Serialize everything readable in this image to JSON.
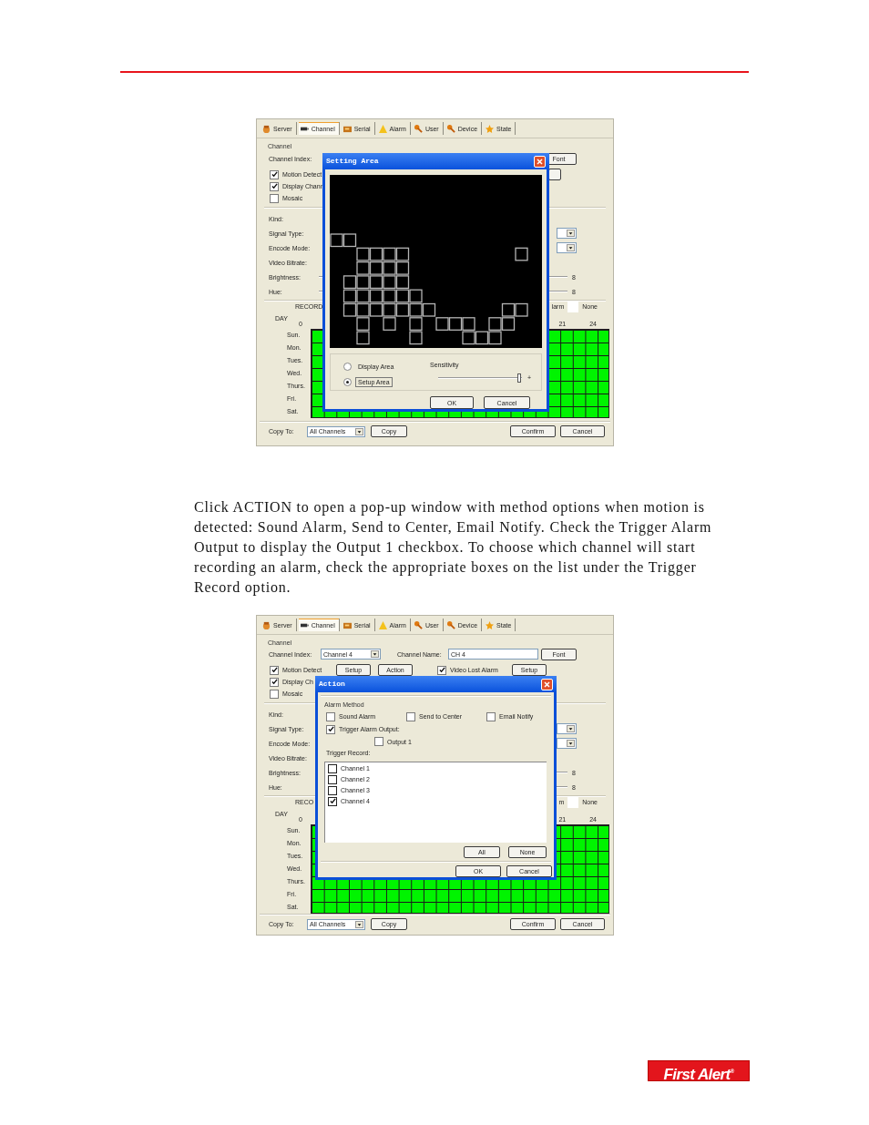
{
  "screenshots": [
    {
      "tabs": [
        {
          "label": "Server",
          "selected": false
        },
        {
          "label": "Channel",
          "selected": true
        },
        {
          "label": "Serial",
          "selected": false
        },
        {
          "label": "Alarm",
          "selected": false
        },
        {
          "label": "User",
          "selected": false
        },
        {
          "label": "Device",
          "selected": false
        },
        {
          "label": "State",
          "selected": false
        }
      ],
      "group_title": "Channel",
      "channel_row": {
        "index_label": "Channel Index:",
        "font_button": "Font"
      },
      "checks": [
        {
          "label": "Motion Detect",
          "checked": true,
          "extras": [
            {
              "kind": "stub"
            }
          ]
        },
        {
          "label": "Display Chann",
          "checked": true
        },
        {
          "label": "Mosaic",
          "checked": false
        }
      ],
      "fields": [
        {
          "label": "Kind:",
          "kind": "plain"
        },
        {
          "label": "Signal Type:",
          "kind": "dropdown"
        },
        {
          "label": "Encode Mode:",
          "kind": "dropdown"
        },
        {
          "label": "Video Bitrate:",
          "kind": "plain"
        },
        {
          "label": "Brightness:",
          "kind": "slider",
          "value": "8"
        },
        {
          "label": "Hue:",
          "kind": "slider",
          "value": "8"
        }
      ],
      "schedule": {
        "record_label": "RECORD",
        "legend_label": "larm",
        "legend_value": "None",
        "day_label": "DAY",
        "hours": [
          "0",
          "21",
          "24"
        ],
        "days": [
          "Sun.",
          "Mon.",
          "Tues.",
          "Wed.",
          "Thurs.",
          "Fri.",
          "Sat."
        ]
      },
      "copy_row": {
        "label": "Copy To:",
        "select": "All Channels",
        "button": "Copy"
      },
      "actions": [
        "Confirm",
        "Cancel"
      ],
      "dialog": {
        "kind": "area",
        "title": "Setting Area",
        "options": [
          {
            "label": "Display Area",
            "selected": false
          },
          {
            "label": "Setup Area",
            "selected": true
          }
        ],
        "sensitivity": {
          "label": "Sensitivity",
          "level": 0.97,
          "plus": "+"
        },
        "buttons": [
          "OK",
          "Cancel"
        ]
      }
    },
    {
      "tabs": [
        {
          "label": "Server",
          "selected": false
        },
        {
          "label": "Channel",
          "selected": true
        },
        {
          "label": "Serial",
          "selected": false
        },
        {
          "label": "Alarm",
          "selected": false
        },
        {
          "label": "User",
          "selected": false
        },
        {
          "label": "Device",
          "selected": false
        },
        {
          "label": "State",
          "selected": false
        }
      ],
      "group_title": "Channel",
      "channel_row": {
        "index_label": "Channel Index:",
        "index_value": "Channel 4",
        "name_label": "Channel Name:",
        "name_value": "CH 4",
        "font_button": "Font"
      },
      "checks": [
        {
          "label": "Motion Detect",
          "checked": true,
          "extras": [
            {
              "kind": "button",
              "label": "Setup"
            },
            {
              "kind": "button",
              "label": "Action"
            },
            {
              "kind": "check",
              "label": "Video Lost Alarm",
              "checked": true
            },
            {
              "kind": "button",
              "label": "Setup"
            }
          ]
        },
        {
          "label": "Display Ch",
          "checked": true
        },
        {
          "label": "Mosaic",
          "checked": false
        }
      ],
      "fields": [
        {
          "label": "Kind:",
          "kind": "plain"
        },
        {
          "label": "Signal Type:",
          "kind": "dropdown"
        },
        {
          "label": "Encode Mode:",
          "kind": "dropdown"
        },
        {
          "label": "Video Bitrate:",
          "kind": "plain"
        },
        {
          "label": "Brightness:",
          "kind": "slider",
          "value": "8"
        },
        {
          "label": "Hue:",
          "kind": "slider",
          "value": "8"
        }
      ],
      "schedule": {
        "record_label": "RECO",
        "legend_label": "m",
        "legend_value": "None",
        "day_label": "DAY",
        "hours": [
          "0",
          "21",
          "24"
        ],
        "days": [
          "Sun.",
          "Mon.",
          "Tues.",
          "Wed.",
          "Thurs.",
          "Fri.",
          "Sat."
        ]
      },
      "copy_row": {
        "label": "Copy To:",
        "select": "All Channels",
        "button": "Copy"
      },
      "actions": [
        "Confirm",
        "Cancel"
      ],
      "dialog": {
        "kind": "action",
        "title": "Action",
        "group_title": "Alarm Method",
        "methods": [
          {
            "label": "Sound Alarm",
            "checked": false
          },
          {
            "label": "Send to Center",
            "checked": false
          },
          {
            "label": "Email Notify",
            "checked": false
          }
        ],
        "output_trigger": {
          "label": "Trigger Alarm Output:",
          "checked": true
        },
        "outputs": [
          {
            "label": "Output 1",
            "checked": false
          }
        ],
        "record_label": "Trigger Record:",
        "channels": [
          {
            "label": "Channel 1",
            "checked": false
          },
          {
            "label": "Channel 2",
            "checked": false
          },
          {
            "label": "Channel 3",
            "checked": false
          },
          {
            "label": "Channel 4",
            "checked": true
          }
        ],
        "list_buttons": [
          "All",
          "None"
        ],
        "buttons": [
          "OK",
          "Cancel"
        ]
      }
    }
  ],
  "paragraph": "Click ACTION to open a pop-up window with method options when motion is detected: Sound Alarm, Send to Center, Email Notify. Check the Trigger Alarm Output to display the Output 1 checkbox. To choose which channel will start recording an alarm, check the appropriate boxes on the list under the Trigger Record option.",
  "logo": "First Alert$^{®}$"
}
